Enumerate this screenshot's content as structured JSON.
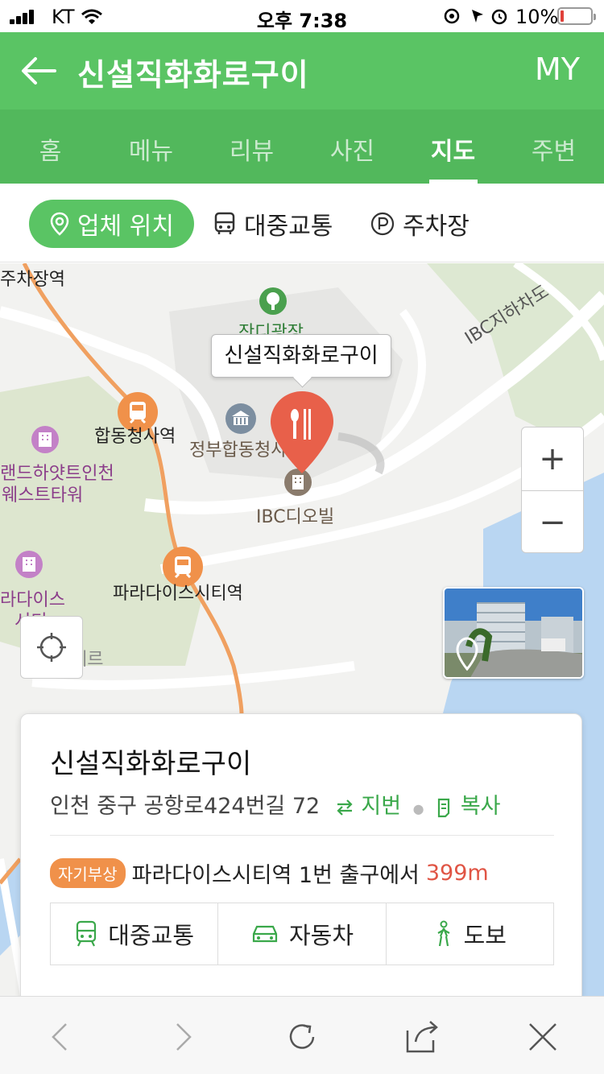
{
  "status_bar": {
    "carrier": "KT",
    "time": "오후 7:38",
    "battery": "10%"
  },
  "header": {
    "title": "신설직화화로구이",
    "my_label": "MY"
  },
  "tabs": [
    {
      "label": "홈"
    },
    {
      "label": "메뉴"
    },
    {
      "label": "리뷰"
    },
    {
      "label": "사진"
    },
    {
      "label": "지도",
      "active": true
    },
    {
      "label": "주변"
    }
  ],
  "filters": {
    "location": "업체 위치",
    "transit": "대중교통",
    "parking": "주차장"
  },
  "map": {
    "callout": "신설직화화로구이",
    "labels": {
      "station_top": "주차장역",
      "plaza": "잔디광장",
      "road": "IBC지하차도",
      "station1": "합동청사역",
      "govt": "정부합동청사",
      "hotel_line1": "랜드하얏트인천",
      "hotel_line2": "웨스트타워",
      "ibc": "IBC디오빌",
      "station2": "파라다이스시티역",
      "paradise_line1": "라다이스",
      "paradise_line2": "시티",
      "misc": "메르"
    },
    "zoom_in": "+",
    "zoom_out": "−"
  },
  "card": {
    "name": "신설직화화로구이",
    "address": "인천 중구 공항로424번길 72",
    "jibun": "지번",
    "copy": "복사",
    "badge": "자기부상",
    "transit_text": "파라다이스시티역 1번 출구에서",
    "distance": "399m",
    "modes": {
      "transit": "대중교통",
      "car": "자동차",
      "walk": "도보"
    }
  },
  "colors": {
    "brand": "#5ac464",
    "tab_bg": "#52b85c",
    "marker": "#e8604a",
    "station": "#f0914a"
  }
}
